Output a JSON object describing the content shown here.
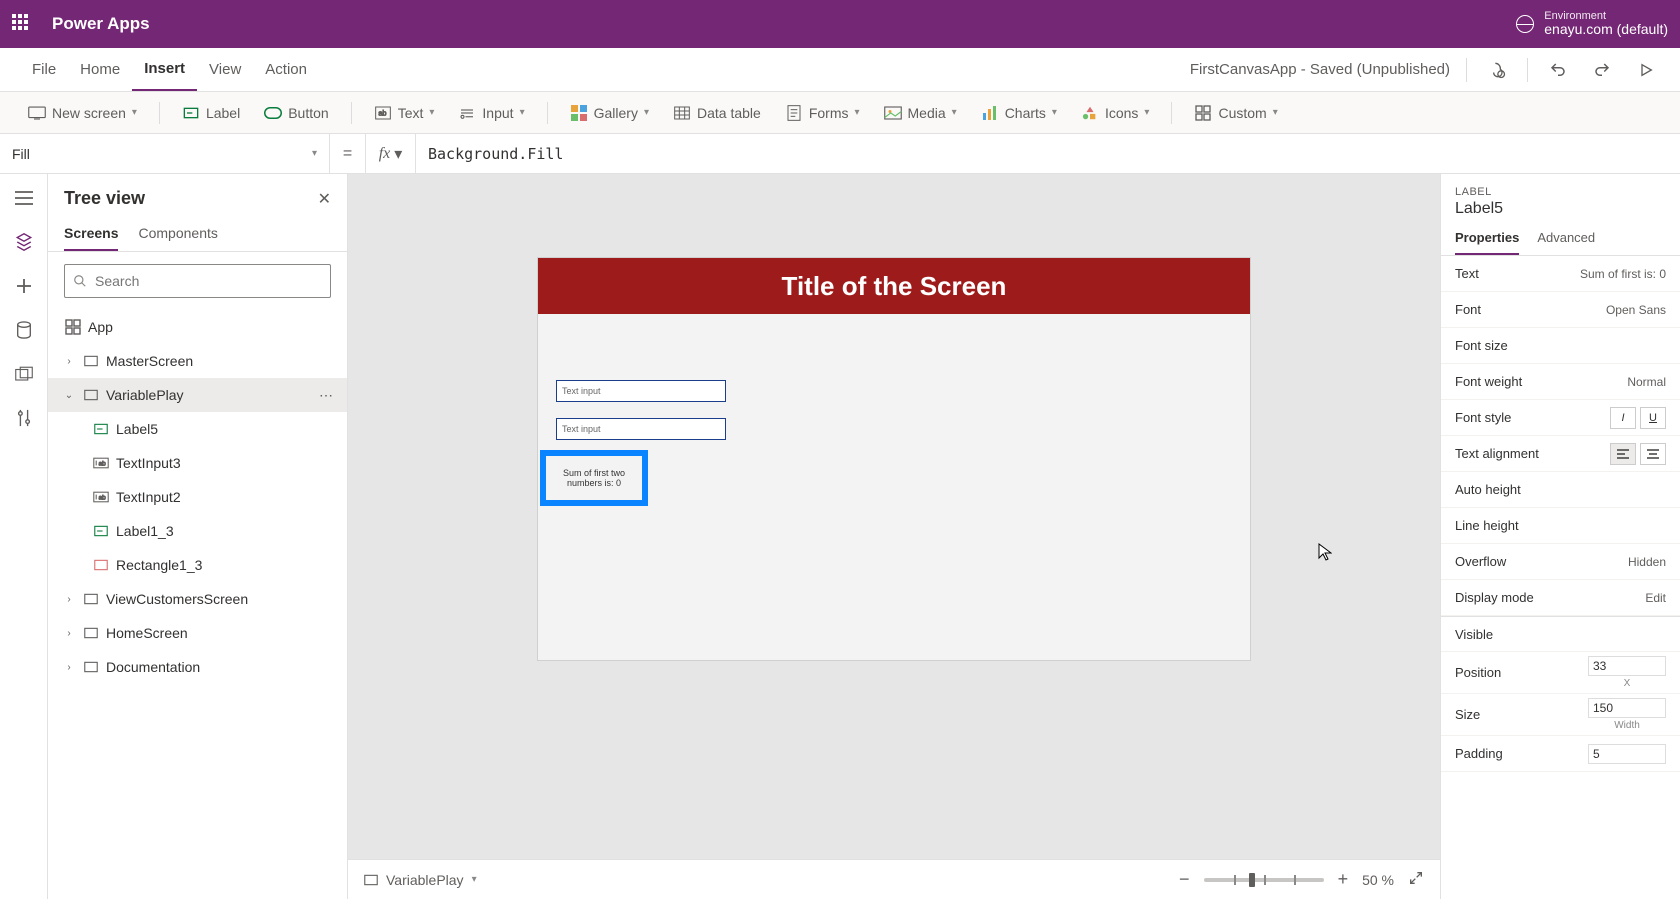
{
  "header": {
    "brand": "Power Apps",
    "env_label": "Environment",
    "env_name": "enayu.com (default)"
  },
  "menubar": {
    "items": [
      "File",
      "Home",
      "Insert",
      "View",
      "Action"
    ],
    "active": "Insert",
    "status": "FirstCanvasApp - Saved (Unpublished)"
  },
  "ribbon": {
    "new_screen": "New screen",
    "label": "Label",
    "button": "Button",
    "text": "Text",
    "input": "Input",
    "gallery": "Gallery",
    "data_table": "Data table",
    "forms": "Forms",
    "media": "Media",
    "charts": "Charts",
    "icons": "Icons",
    "custom": "Custom"
  },
  "formula": {
    "property": "Fill",
    "value": "Background.Fill"
  },
  "tree": {
    "title": "Tree view",
    "tabs": [
      "Screens",
      "Components"
    ],
    "active_tab": "Screens",
    "search_placeholder": "Search",
    "app": "App",
    "nodes": {
      "master": "MasterScreen",
      "variableplay": "VariablePlay",
      "label5": "Label5",
      "textinput3": "TextInput3",
      "textinput2": "TextInput2",
      "label1_3": "Label1_3",
      "rectangle1_3": "Rectangle1_3",
      "viewcustomers": "ViewCustomersScreen",
      "homescreen": "HomeScreen",
      "documentation": "Documentation"
    }
  },
  "canvas": {
    "header_title": "Title of the Screen",
    "textinput_placeholder": "Text input",
    "label_text": "Sum of first two numbers is: 0"
  },
  "statusbar": {
    "screen": "VariablePlay",
    "zoom": "50 %"
  },
  "props": {
    "type": "LABEL",
    "name": "Label5",
    "tabs": [
      "Properties",
      "Advanced"
    ],
    "active_tab": "Properties",
    "rows": {
      "text": {
        "label": "Text",
        "value": "Sum of first is: 0"
      },
      "font": {
        "label": "Font",
        "value": "Open Sans"
      },
      "font_size": {
        "label": "Font size"
      },
      "font_weight": {
        "label": "Font weight",
        "value": "Normal"
      },
      "font_style": {
        "label": "Font style"
      },
      "text_alignment": {
        "label": "Text alignment"
      },
      "auto_height": {
        "label": "Auto height"
      },
      "line_height": {
        "label": "Line height"
      },
      "overflow": {
        "label": "Overflow",
        "value": "Hidden"
      },
      "display_mode": {
        "label": "Display mode",
        "value": "Edit"
      },
      "visible": {
        "label": "Visible"
      },
      "position": {
        "label": "Position",
        "value": "33",
        "sub": "X"
      },
      "size": {
        "label": "Size",
        "value": "150",
        "sub": "Width"
      },
      "padding": {
        "label": "Padding",
        "value": "5"
      }
    }
  }
}
